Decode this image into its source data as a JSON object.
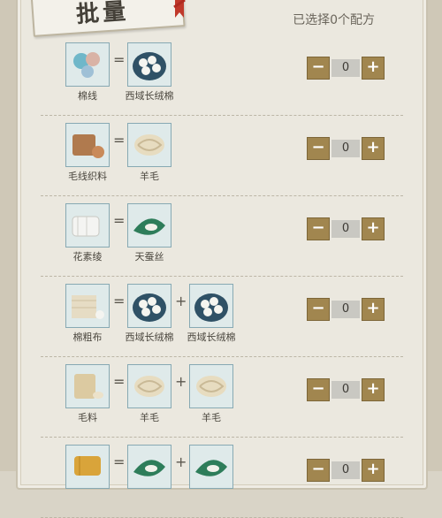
{
  "header": {
    "title": "批量",
    "selected_text": "已选择0个配方"
  },
  "recipes": [
    {
      "result": {
        "label": "棉线",
        "icon": "cotton-yarn-icon"
      },
      "ingredients": [
        {
          "label": "西域长绒棉",
          "icon": "cotton-boll-icon"
        }
      ],
      "quantity": "0"
    },
    {
      "result": {
        "label": "毛线织料",
        "icon": "wool-fabric-icon"
      },
      "ingredients": [
        {
          "label": "羊毛",
          "icon": "wool-icon"
        }
      ],
      "quantity": "0"
    },
    {
      "result": {
        "label": "花素绫",
        "icon": "plain-silk-icon"
      },
      "ingredients": [
        {
          "label": "天蚕丝",
          "icon": "silkworm-leaf-icon"
        }
      ],
      "quantity": "0"
    },
    {
      "result": {
        "label": "棉粗布",
        "icon": "coarse-cotton-cloth-icon"
      },
      "ingredients": [
        {
          "label": "西域长绒棉",
          "icon": "cotton-boll-icon"
        },
        {
          "label": "西域长绒棉",
          "icon": "cotton-boll-icon"
        }
      ],
      "quantity": "0"
    },
    {
      "result": {
        "label": "毛料",
        "icon": "wool-cloth-icon"
      },
      "ingredients": [
        {
          "label": "羊毛",
          "icon": "wool-icon"
        },
        {
          "label": "羊毛",
          "icon": "wool-icon"
        }
      ],
      "quantity": "0"
    },
    {
      "result": {
        "label": "",
        "icon": "silk-bolt-icon"
      },
      "ingredients": [
        {
          "label": "",
          "icon": "silkworm-leaf-icon"
        },
        {
          "label": "",
          "icon": "silkworm-leaf-icon"
        }
      ],
      "quantity": "0"
    }
  ],
  "controls": {
    "minus": "−",
    "plus": "+",
    "equals": "=",
    "and": "+"
  }
}
